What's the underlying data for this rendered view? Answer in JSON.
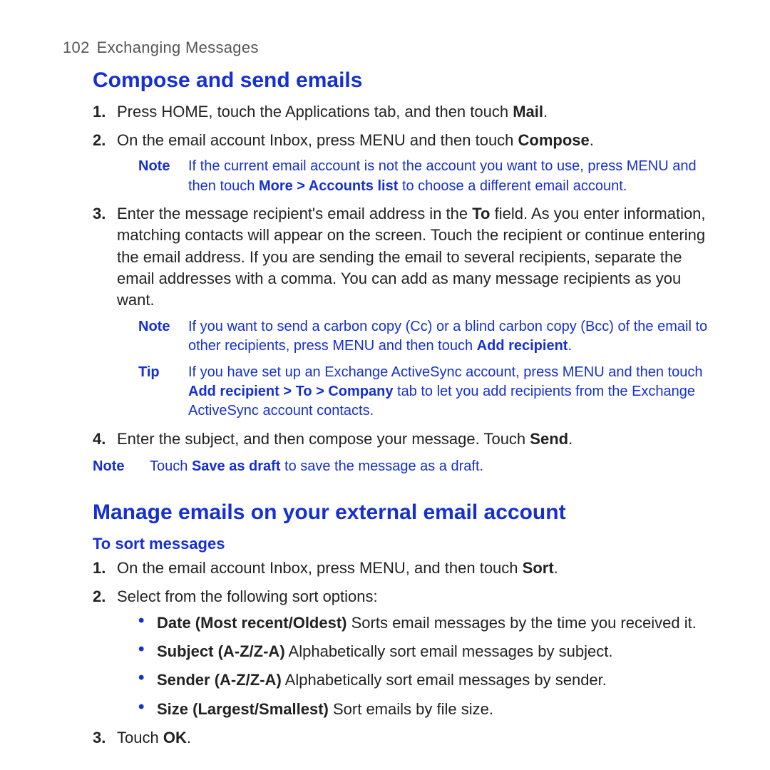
{
  "header": {
    "page_number": "102",
    "chapter": "Exchanging Messages"
  },
  "section1": {
    "title": "Compose and send emails",
    "step1_num": "1.",
    "step1_a": "Press HOME, touch the Applications tab, and then touch ",
    "step1_b": "Mail",
    "step1_c": ".",
    "step2_num": "2.",
    "step2_a": "On the email account Inbox, press MENU and then touch ",
    "step2_b": "Compose",
    "step2_c": ".",
    "step2_note_label": "Note",
    "step2_note_a": "If the current email account is not the account you want to use, press MENU and then touch ",
    "step2_note_b": "More > Accounts list",
    "step2_note_c": " to choose a different email account.",
    "step3_num": "3.",
    "step3_a": "Enter the message recipient's email address in the ",
    "step3_b": "To",
    "step3_c": " field. As you enter information, matching contacts will appear on the screen. Touch the recipient or continue entering the email address. If you are sending the email to several recipients, separate the email addresses with a comma. You can add as many message recipients as you want.",
    "step3_note_label": "Note",
    "step3_note_a": "If you want to send a carbon copy (Cc) or a blind carbon copy (Bcc) of the email to other recipients, press MENU and then touch ",
    "step3_note_b": "Add recipient",
    "step3_note_c": ".",
    "step3_tip_label": "Tip",
    "step3_tip_a": "If you have set up an Exchange ActiveSync account, press MENU and then touch ",
    "step3_tip_b": "Add recipient > To > Company",
    "step3_tip_c": " tab to let you add recipients from the Exchange ActiveSync account contacts.",
    "step4_num": "4.",
    "step4_a": "Enter the subject, and then compose your message. Touch ",
    "step4_b": "Send",
    "step4_c": ".",
    "final_note_label": "Note",
    "final_note_a": "Touch ",
    "final_note_b": "Save as draft",
    "final_note_c": " to save the message as a draft."
  },
  "section2": {
    "title": "Manage emails on your external email account",
    "subheading": "To sort messages",
    "step1_num": "1.",
    "step1_a": "On the email account Inbox, press MENU, and then touch ",
    "step1_b": "Sort",
    "step1_c": ".",
    "step2_num": "2.",
    "step2_text": "Select from the following sort options:",
    "bullet1_b": "Date (Most recent/Oldest)",
    "bullet1_t": "  Sorts email messages by the time you received it.",
    "bullet2_b": "Subject (A-Z/Z-A)",
    "bullet2_t": "  Alphabetically sort email messages by subject.",
    "bullet3_b": "Sender (A-Z/Z-A)",
    "bullet3_t": "  Alphabetically sort email messages by sender.",
    "bullet4_b": "Size (Largest/Smallest)",
    "bullet4_t": "  Sort emails by file size.",
    "step3_num": "3.",
    "step3_a": "Touch ",
    "step3_b": "OK",
    "step3_c": "."
  }
}
